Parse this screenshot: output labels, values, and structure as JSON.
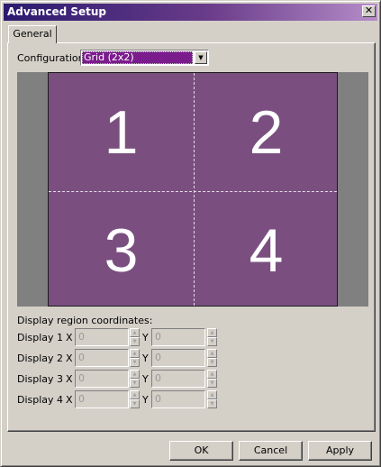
{
  "window": {
    "title": "Advanced Setup"
  },
  "tabs": [
    {
      "label": "General"
    }
  ],
  "configuration": {
    "label": "Configuration:",
    "value": "Grid (2x2)"
  },
  "preview": {
    "cells": [
      "1",
      "2",
      "3",
      "4"
    ]
  },
  "coordinates": {
    "title": "Display region coordinates:",
    "x_label": "X",
    "y_label": "Y",
    "rows": [
      {
        "label": "Display 1",
        "x": "0",
        "y": "0"
      },
      {
        "label": "Display 2",
        "x": "0",
        "y": "0"
      },
      {
        "label": "Display 3",
        "x": "0",
        "y": "0"
      },
      {
        "label": "Display 4",
        "x": "0",
        "y": "0"
      }
    ]
  },
  "buttons": {
    "ok": "OK",
    "cancel": "Cancel",
    "apply": "Apply"
  },
  "icons": {
    "close": "close-icon",
    "dropdown": "chevron-down-icon",
    "spin_up": "spin-up-icon",
    "spin_down": "spin-down-icon"
  },
  "colors": {
    "titlebar_start": "#2a1a6f",
    "titlebar_end": "#b58cc9",
    "screen": "#7a4f80",
    "selection": "#7b1c8c",
    "dialog": "#d4d0c8"
  }
}
